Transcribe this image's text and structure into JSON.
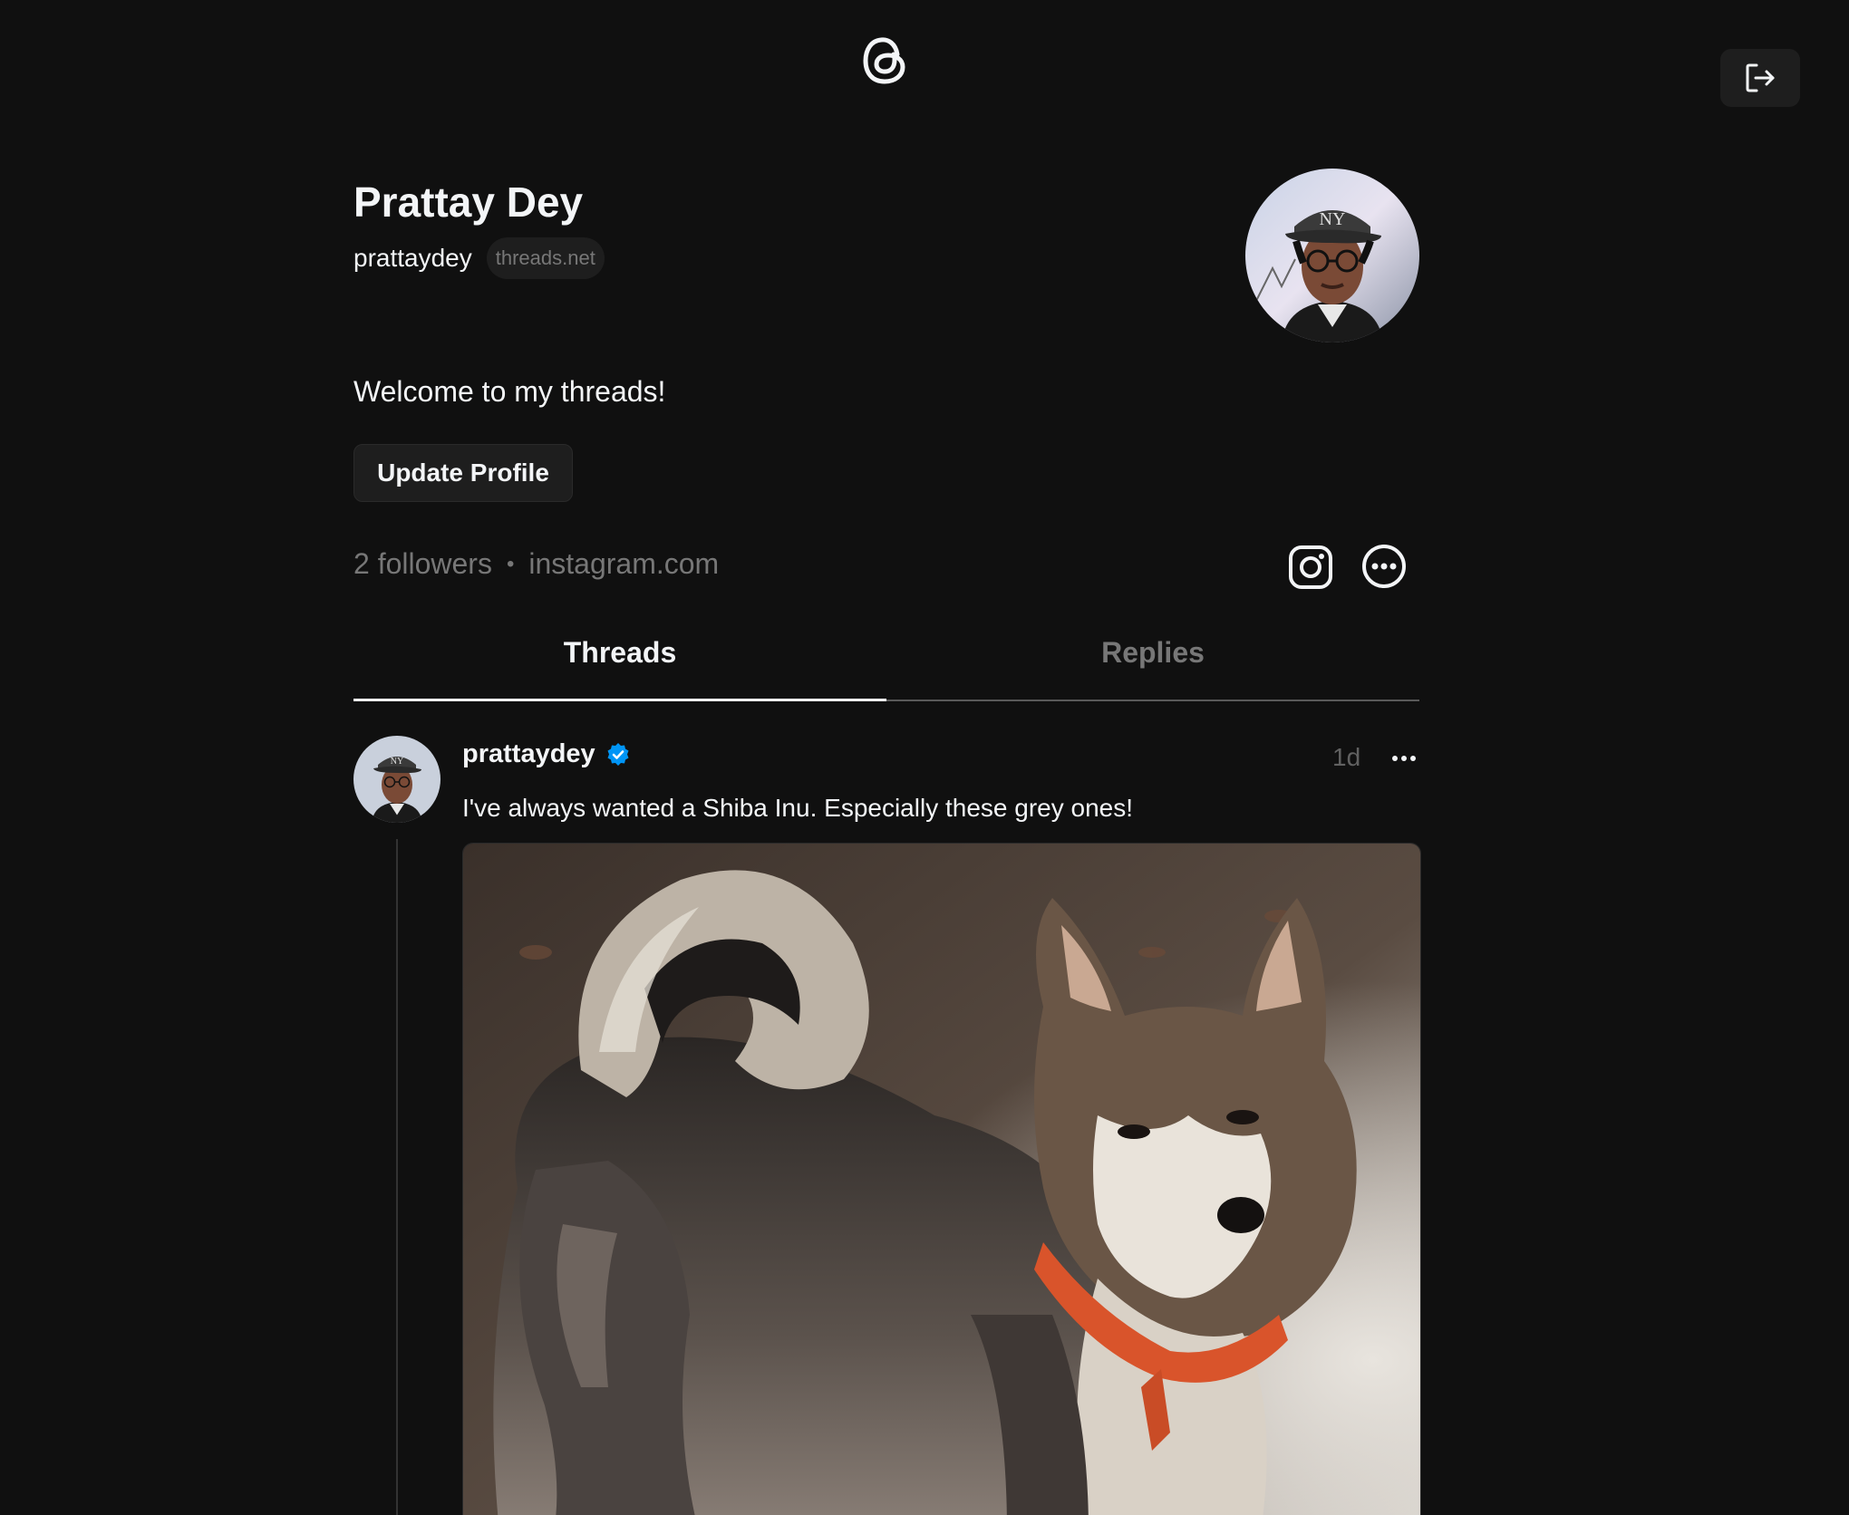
{
  "header": {
    "logo_icon": "threads-logo-icon",
    "logout_icon": "logout-icon"
  },
  "profile": {
    "name": "Prattay Dey",
    "handle": "prattaydey",
    "domain": "threads.net",
    "bio": "Welcome to my threads!",
    "update_button_label": "Update Profile",
    "followers": "2 followers",
    "separator": "•",
    "link": "instagram.com",
    "avatar_icon": "profile-photo"
  },
  "tabs": [
    {
      "label": "Threads",
      "active": true
    },
    {
      "label": "Replies",
      "active": false
    }
  ],
  "post": {
    "username": "prattaydey",
    "verified": true,
    "time": "1d",
    "text": "I've always wanted a Shiba Inu. Especially these grey ones!",
    "image": "shiba-inu-photo"
  },
  "colors": {
    "background": "#101010",
    "text_primary": "#f3f5f7",
    "text_secondary": "#777777",
    "verified_blue": "#0095f6",
    "button_bg": "#1e1e1e"
  }
}
